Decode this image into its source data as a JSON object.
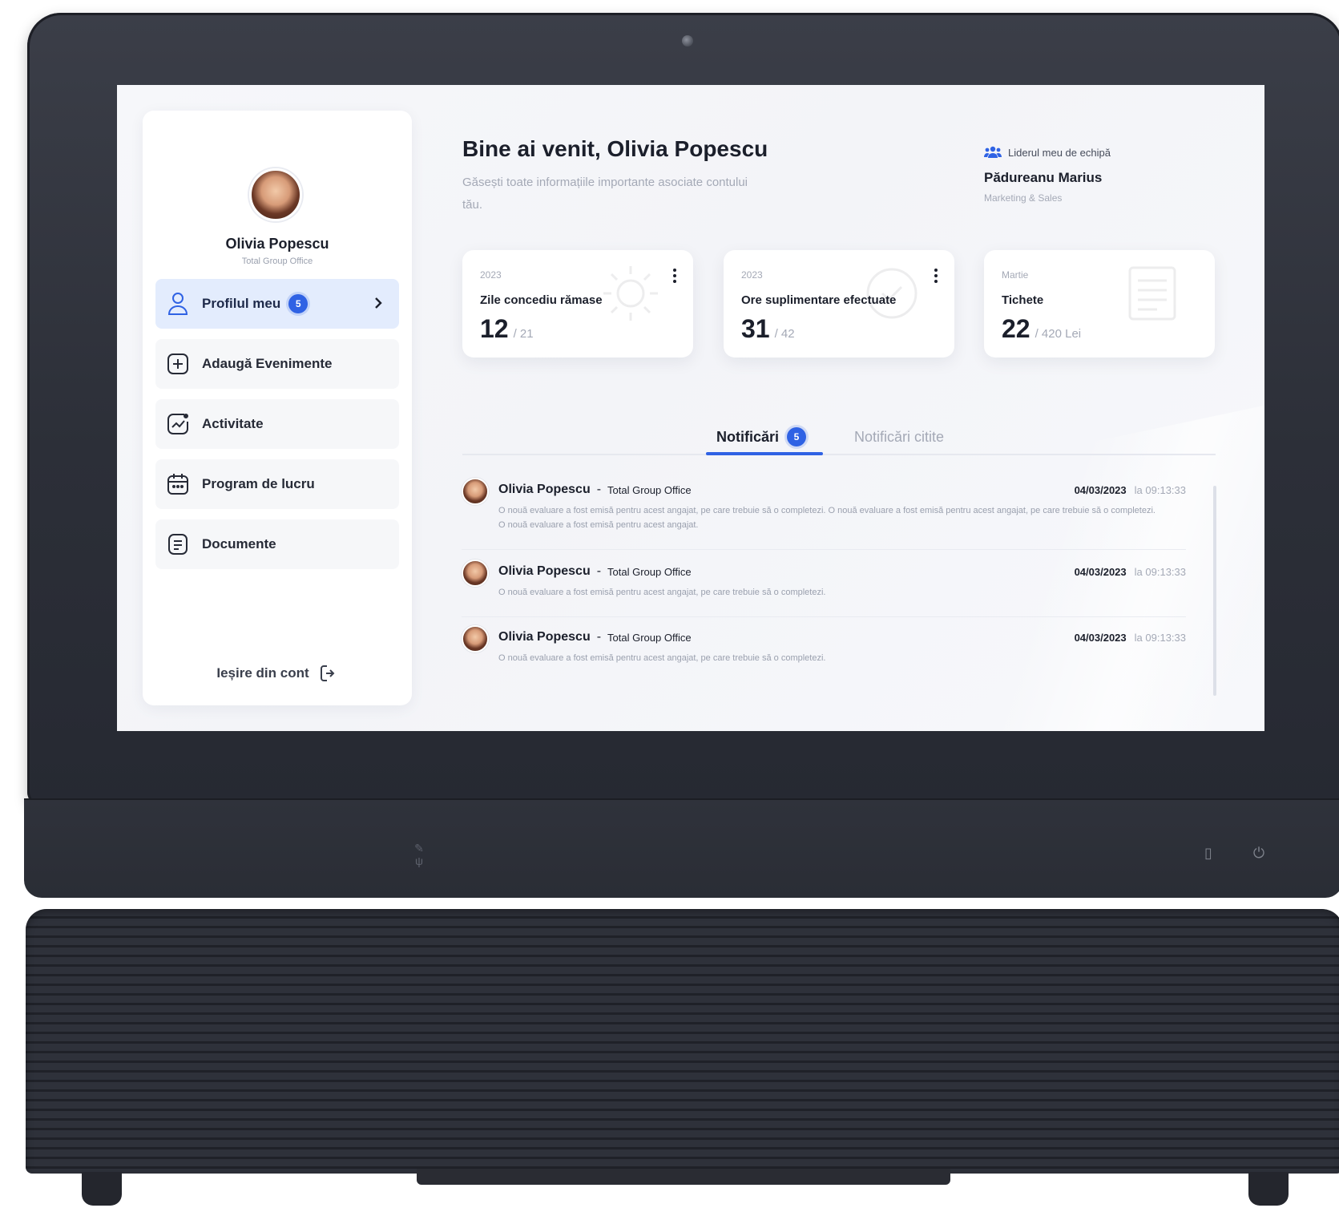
{
  "sidebar": {
    "user_name": "Olivia Popescu",
    "company": "Total Group Office",
    "items": [
      {
        "label": "Profilul meu",
        "badge": "5",
        "icon": "user-icon"
      },
      {
        "label": "Adaugă Evenimente",
        "icon": "plus-square-icon"
      },
      {
        "label": "Activitate",
        "icon": "activity-chart-icon"
      },
      {
        "label": "Program de lucru",
        "icon": "calendar-icon"
      },
      {
        "label": "Documente",
        "icon": "document-icon"
      }
    ],
    "logout_label": "Ieșire din cont"
  },
  "header": {
    "title": "Bine ai venit, Olivia Popescu",
    "subtitle": "Găsești toate informațiile importante asociate contului tău.",
    "leader_label": "Liderul meu de echipă",
    "leader_name": "Pădureanu Marius",
    "leader_dept": "Marketing & Sales"
  },
  "stats": [
    {
      "period": "2023",
      "title": "Zile concediu rămase",
      "value": "12",
      "total": "/ 21"
    },
    {
      "period": "2023",
      "title": "Ore suplimentare efectuate",
      "value": "31",
      "total": "/ 42"
    },
    {
      "period": "Martie",
      "title": "Tichete",
      "value": "22",
      "total": "/ 420 Lei"
    }
  ],
  "tabs": {
    "active_label": "Notificări",
    "active_badge": "5",
    "inactive_label": "Notificări citite"
  },
  "notifications": [
    {
      "name": "Olivia Popescu",
      "separator": "-",
      "company": "Total Group Office",
      "date": "04/03/2023",
      "time": "la 09:13:33",
      "message": "O nouă evaluare a fost emisă pentru acest angajat, pe care trebuie să o completezi. O nouă evaluare a fost emisă pentru acest angajat, pe care trebuie să o completezi. O nouă evaluare a fost emisă pentru acest angajat."
    },
    {
      "name": "Olivia Popescu",
      "separator": "-",
      "company": "Total Group Office",
      "date": "04/03/2023",
      "time": "la 09:13:33",
      "message": "O nouă evaluare a fost emisă pentru acest angajat, pe care trebuie să o completezi."
    },
    {
      "name": "Olivia Popescu",
      "separator": "-",
      "company": "Total Group Office",
      "date": "04/03/2023",
      "time": "la 09:13:33",
      "message": "O nouă evaluare a fost emisă pentru acest angajat, pe care trebuie să o completezi."
    }
  ],
  "colors": {
    "accent": "#2f62e4",
    "active_nav_bg": "#e3ecfd",
    "device_body": "#2c2f38"
  }
}
